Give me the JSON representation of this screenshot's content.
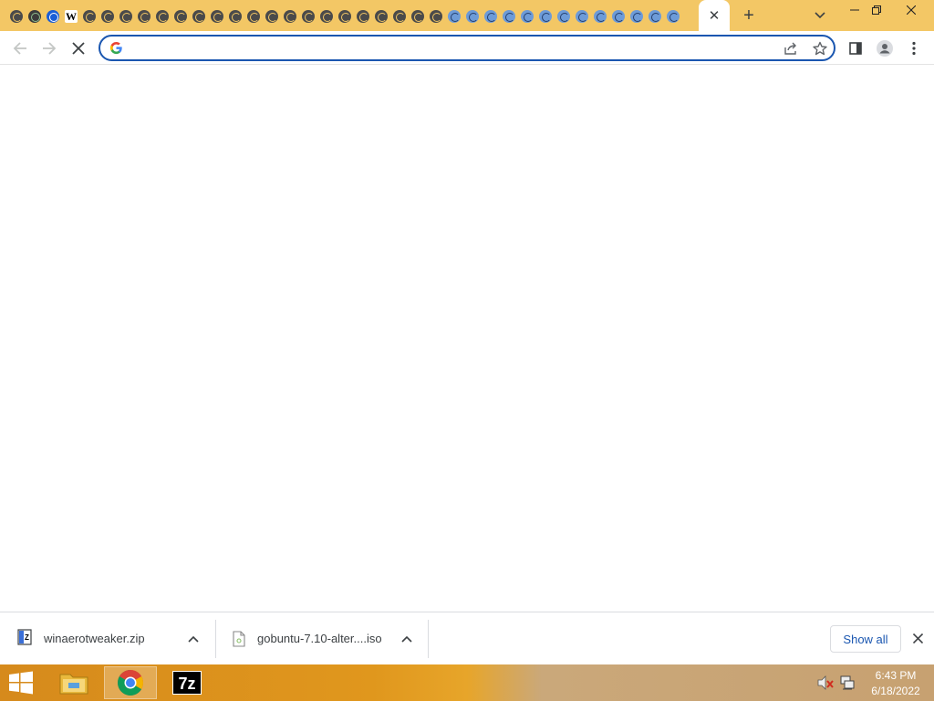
{
  "browser": {
    "tab_favicons": [
      "chrome",
      "globe",
      "triangle",
      "wiki",
      "chrome",
      "chrome",
      "chrome",
      "chrome",
      "chrome",
      "chrome",
      "chrome",
      "chrome",
      "chrome",
      "chrome",
      "chrome",
      "chrome",
      "chrome",
      "chrome",
      "chrome",
      "chrome",
      "chrome",
      "chrome",
      "chrome",
      "chrome",
      "spin",
      "spin",
      "spin",
      "spin",
      "spin",
      "spin",
      "spin",
      "spin",
      "spin",
      "spin",
      "spin",
      "spin",
      "spin"
    ],
    "wiki_letter": "W",
    "close_tab_glyph": "✕",
    "new_tab_glyph": "+",
    "omnibox": {
      "value": "",
      "placeholder": ""
    }
  },
  "downloads": {
    "items": [
      {
        "name": "winaerotweaker.zip"
      },
      {
        "name": "gobuntu-7.10-alter....iso"
      }
    ],
    "show_all_label": "Show all"
  },
  "taskbar": {
    "time": "6:43 PM",
    "date": "6/18/2022",
    "seven_zip_label": "7z"
  },
  "colors": {
    "tabstrip": "#f3c765",
    "omnibox_border": "#1a56b0",
    "taskbar": "#e0971d",
    "show_all_text": "#1a56b0"
  }
}
